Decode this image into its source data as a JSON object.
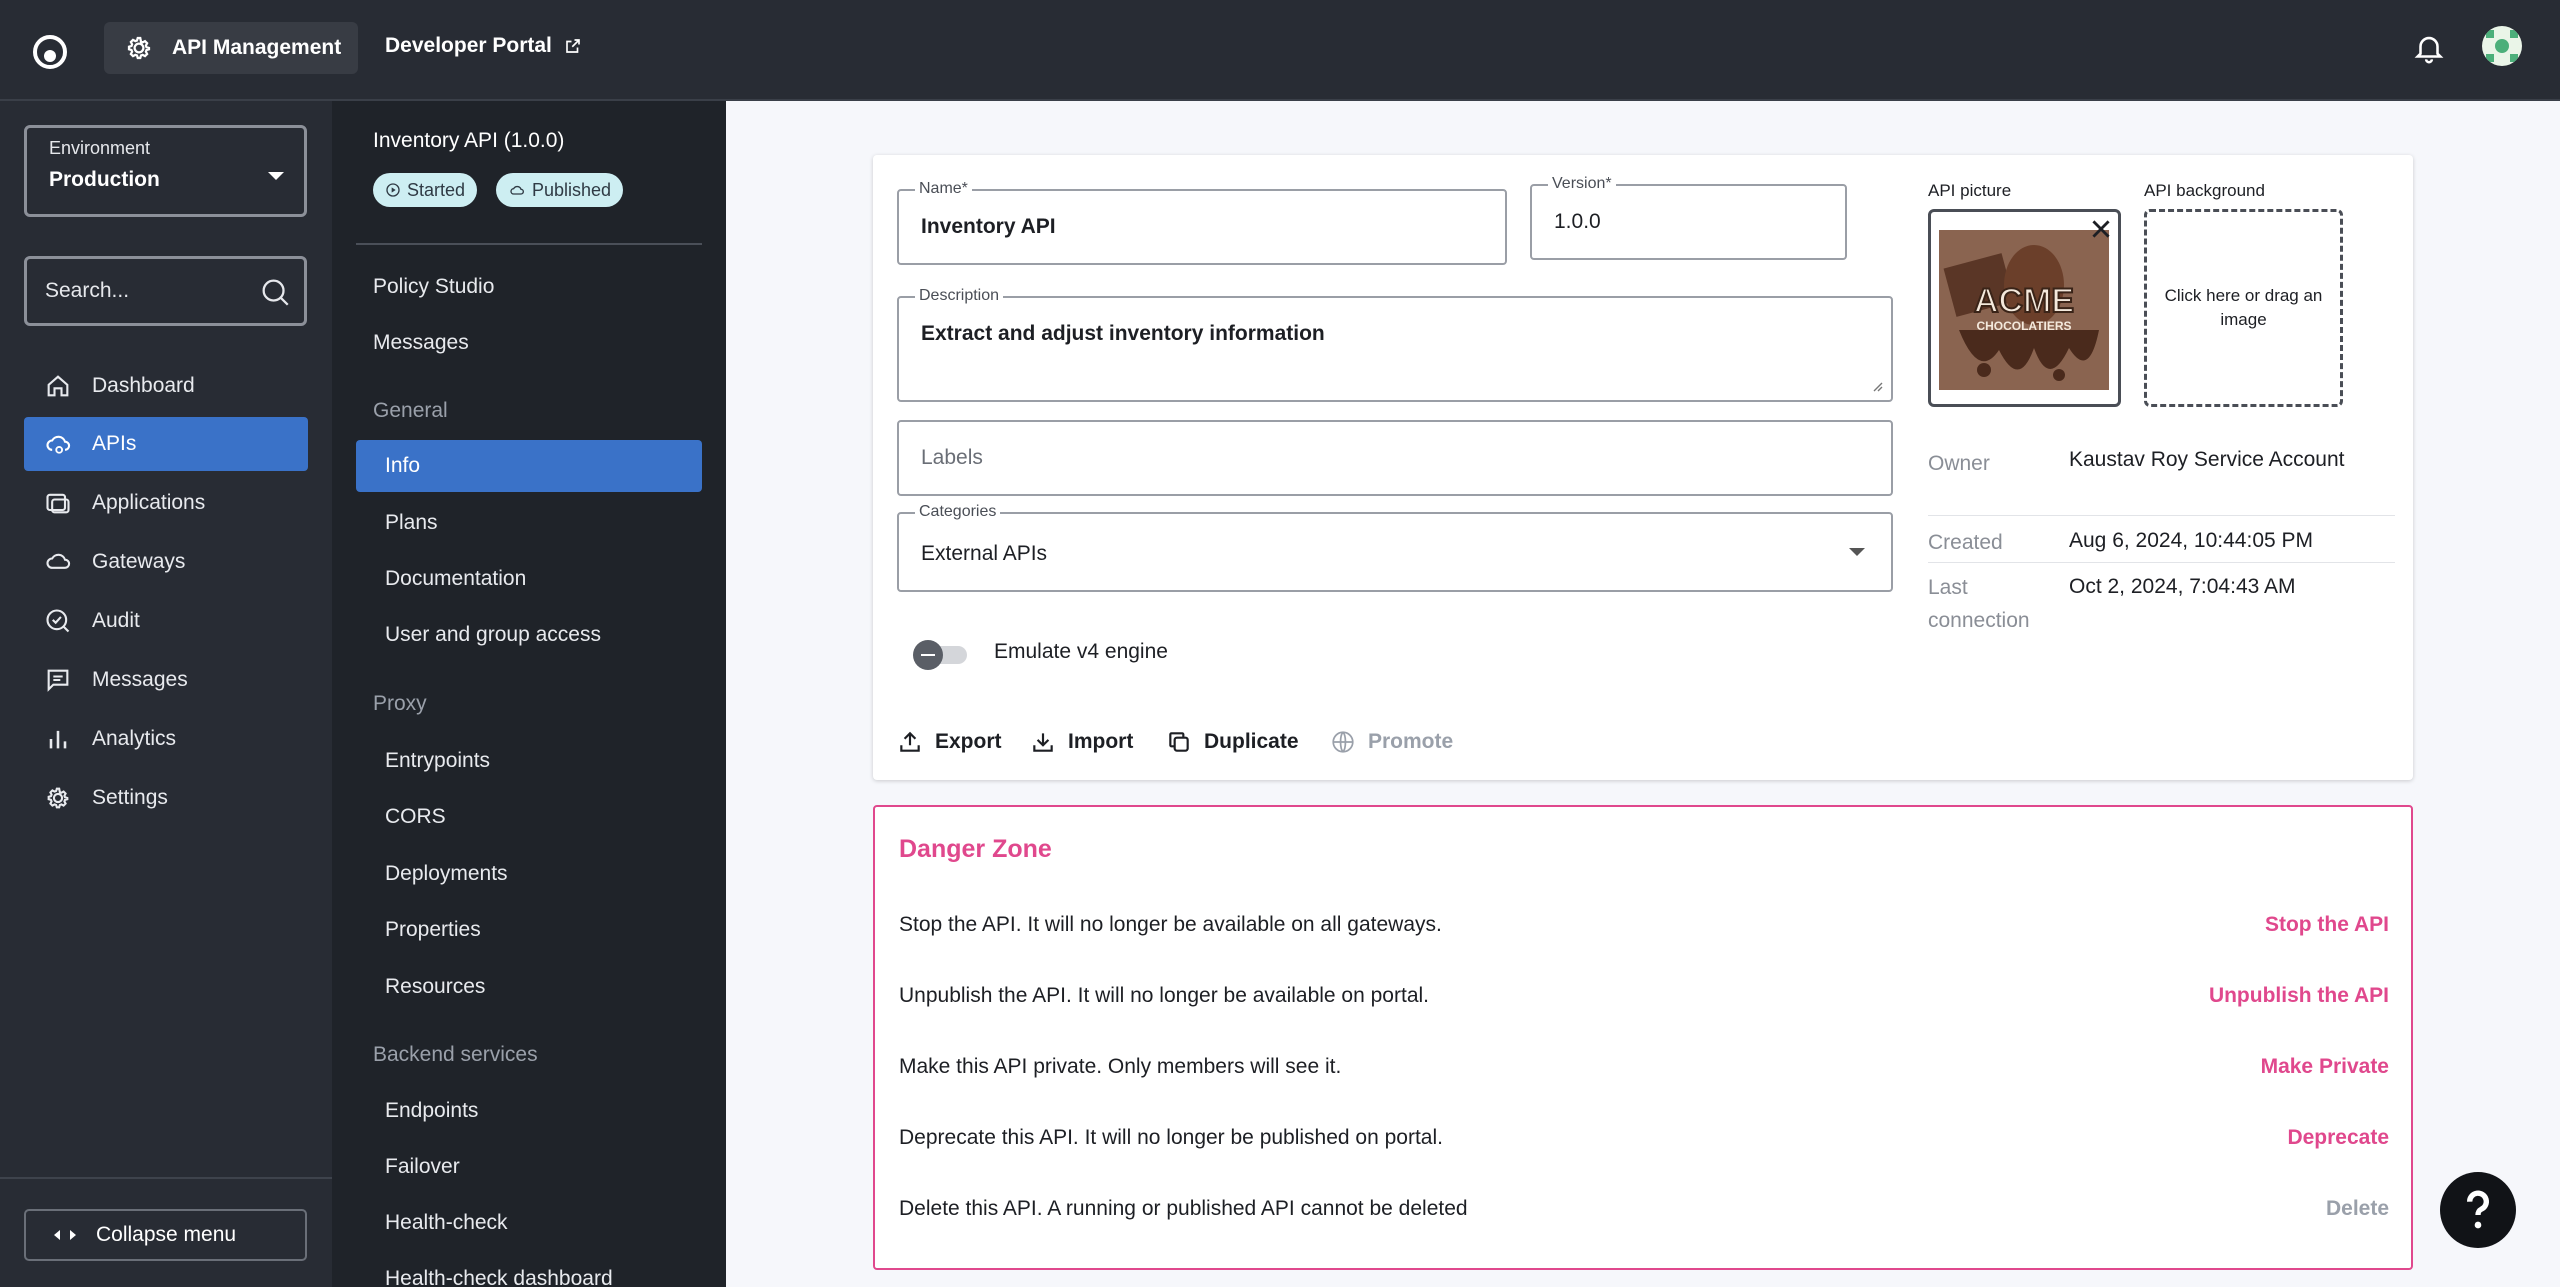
{
  "header": {
    "product": "API Management",
    "dev_portal": "Developer Portal"
  },
  "sidebar": {
    "env_label": "Environment",
    "env_value": "Production",
    "search_placeholder": "Search...",
    "items": [
      {
        "label": "Dashboard",
        "icon": "home-icon"
      },
      {
        "label": "APIs",
        "icon": "cloud-api-icon"
      },
      {
        "label": "Applications",
        "icon": "applications-icon"
      },
      {
        "label": "Gateways",
        "icon": "gateway-icon"
      },
      {
        "label": "Audit",
        "icon": "audit-icon"
      },
      {
        "label": "Messages",
        "icon": "messages-icon"
      },
      {
        "label": "Analytics",
        "icon": "analytics-icon"
      },
      {
        "label": "Settings",
        "icon": "gear-icon"
      }
    ],
    "collapse": "Collapse menu"
  },
  "subnav": {
    "api_title": "Inventory API (1.0.0)",
    "badge_started": "Started",
    "badge_published": "Published",
    "policy_studio": "Policy Studio",
    "messages": "Messages",
    "general": "General",
    "info": "Info",
    "plans": "Plans",
    "documentation": "Documentation",
    "user_access": "User and group access",
    "proxy": "Proxy",
    "entrypoints": "Entrypoints",
    "cors": "CORS",
    "deployments": "Deployments",
    "properties": "Properties",
    "resources": "Resources",
    "backend": "Backend services",
    "endpoints": "Endpoints",
    "failover": "Failover",
    "health_check": "Health-check",
    "health_dashboard": "Health-check dashboard"
  },
  "form": {
    "name_label": "Name*",
    "name_value": "Inventory API",
    "version_label": "Version*",
    "version_value": "1.0.0",
    "desc_label": "Description",
    "desc_value": "Extract and adjust inventory information",
    "labels_placeholder": "Labels",
    "categories_label": "Categories",
    "categories_value": "External APIs",
    "emulate_label": "Emulate v4 engine",
    "emulate_on": false,
    "export": "Export",
    "import": "Import",
    "duplicate": "Duplicate",
    "promote": "Promote",
    "picture_label": "API picture",
    "background_label": "API background",
    "background_hint": "Click here or drag an image",
    "logo_text_1": "ACME",
    "logo_text_2": "CHOCOLATIERS"
  },
  "meta": {
    "owner_label": "Owner",
    "owner_value": "Kaustav Roy Service Account",
    "created_label": "Created",
    "created_value": "Aug 6, 2024, 10:44:05 PM",
    "last_label_1": "Last",
    "last_label_2": "connection",
    "last_value": "Oct 2, 2024, 7:04:43 AM"
  },
  "danger": {
    "title": "Danger Zone",
    "rows": [
      {
        "text": "Stop the API. It will no longer be available on all gateways.",
        "action": "Stop the API"
      },
      {
        "text": "Unpublish the API. It will no longer be available on portal.",
        "action": "Unpublish the API"
      },
      {
        "text": "Make this API private. Only members will see it.",
        "action": "Make Private"
      },
      {
        "text": "Deprecate this API. It will no longer be published on portal.",
        "action": "Deprecate"
      },
      {
        "text": "Delete this API. A running or published API cannot be deleted",
        "action": "Delete"
      }
    ]
  },
  "colors": {
    "accent": "#3a72c8",
    "danger": "#e0488d",
    "topbar": "#282c34"
  }
}
